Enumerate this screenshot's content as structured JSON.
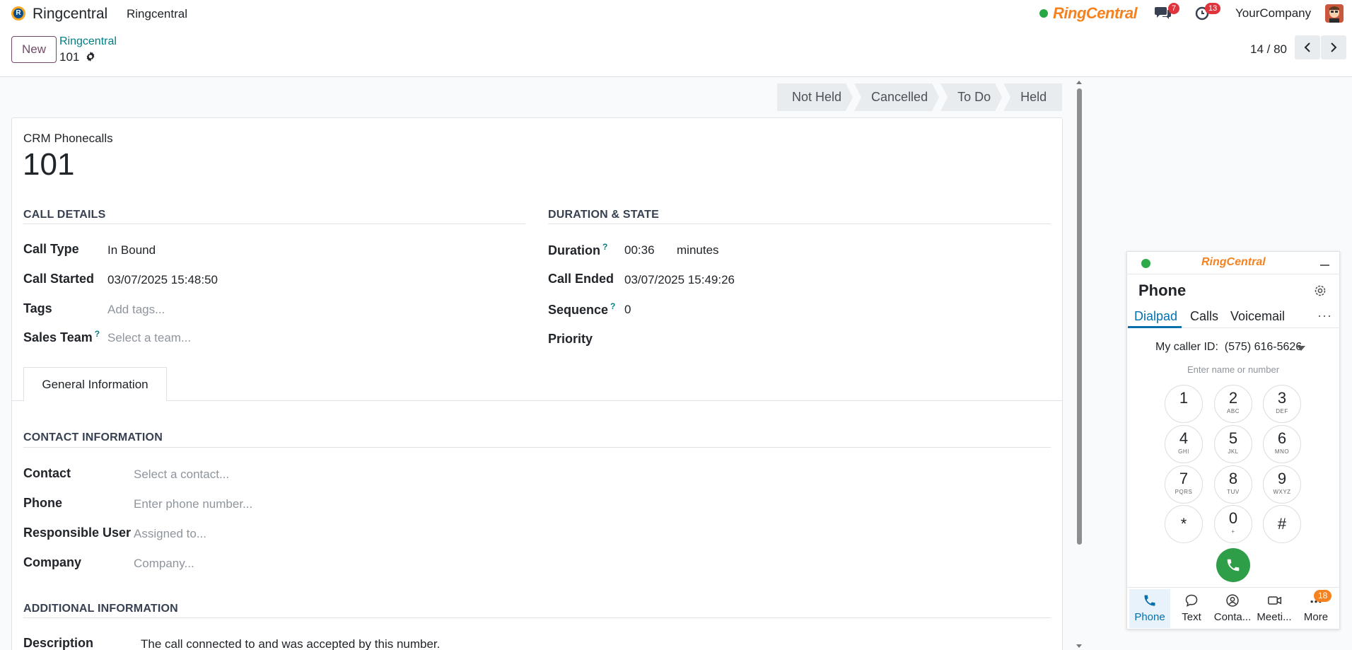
{
  "navbar": {
    "app_name": "Ringcentral",
    "menu_item": "Ringcentral",
    "rc_brand": "RingCentral",
    "messages_count": "7",
    "activities_count": "13",
    "company": "YourCompany"
  },
  "control": {
    "new_label": "New",
    "breadcrumb_parent": "Ringcentral",
    "breadcrumb_current": "101",
    "pager": "14 / 80"
  },
  "statusbar": {
    "stages": [
      "Not Held",
      "Cancelled",
      "To Do",
      "Held"
    ]
  },
  "form": {
    "model_label": "CRM Phonecalls",
    "name": "101",
    "call_details": {
      "title": "CALL DETAILS",
      "call_type_label": "Call Type",
      "call_type_value": "In Bound",
      "call_started_label": "Call Started",
      "call_started_value": "03/07/2025 15:48:50",
      "tags_label": "Tags",
      "tags_placeholder": "Add tags...",
      "sales_team_label": "Sales Team",
      "sales_team_placeholder": "Select a team..."
    },
    "duration_state": {
      "title": "DURATION & STATE",
      "duration_label": "Duration",
      "duration_value": "00:36",
      "duration_unit": "minutes",
      "call_ended_label": "Call Ended",
      "call_ended_value": "03/07/2025 15:49:26",
      "sequence_label": "Sequence",
      "sequence_value": "0",
      "priority_label": "Priority"
    },
    "help_mark": "?",
    "tab_general": "General Information",
    "contact_info": {
      "title": "CONTACT INFORMATION",
      "contact_label": "Contact",
      "contact_placeholder": "Select a contact...",
      "phone_label": "Phone",
      "phone_placeholder": "Enter phone number...",
      "responsible_label": "Responsible User",
      "responsible_placeholder": "Assigned to...",
      "company_label": "Company",
      "company_placeholder": "Company..."
    },
    "additional_info": {
      "title": "ADDITIONAL INFORMATION",
      "description_label": "Description",
      "description_value": "The call connected to and was accepted by this number."
    }
  },
  "widget": {
    "brand": "RingCentral",
    "title": "Phone",
    "tabs": [
      "Dialpad",
      "Calls",
      "Voicemail"
    ],
    "more_dots": "···",
    "caller_id_label": "My caller ID:",
    "caller_id_value": "(575) 616-5626",
    "input_placeholder": "Enter name or number",
    "keys": [
      {
        "d": "1",
        "l": ""
      },
      {
        "d": "2",
        "l": "ABC"
      },
      {
        "d": "3",
        "l": "DEF"
      },
      {
        "d": "4",
        "l": "GHI"
      },
      {
        "d": "5",
        "l": "JKL"
      },
      {
        "d": "6",
        "l": "MNO"
      },
      {
        "d": "7",
        "l": "PQRS"
      },
      {
        "d": "8",
        "l": "TUV"
      },
      {
        "d": "9",
        "l": "WXYZ"
      },
      {
        "d": "*",
        "l": ""
      },
      {
        "d": "0",
        "l": "+"
      },
      {
        "d": "#",
        "l": ""
      }
    ],
    "nav": [
      "Phone",
      "Text",
      "Conta...",
      "Meeti...",
      "More"
    ],
    "more_badge": "18",
    "accent": "#066fac",
    "call_green": "#2f9e48"
  }
}
